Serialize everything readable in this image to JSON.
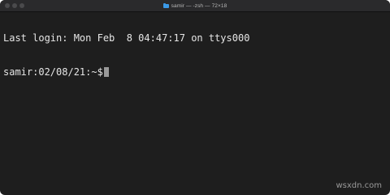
{
  "window": {
    "title": "samir — -zsh — 72×18"
  },
  "terminal": {
    "lines": [
      "Last login: Mon Feb  8 04:47:17 on ttys000"
    ],
    "prompt": "samir:02/08/21:~$"
  },
  "watermark": "wsxdn.com",
  "icons": {
    "title_icon": "folder-icon"
  },
  "colors": {
    "background": "#1e1e1e",
    "text": "#e6e6e6",
    "cursor": "#9a9a9a",
    "folder": "#3b9ae8"
  }
}
